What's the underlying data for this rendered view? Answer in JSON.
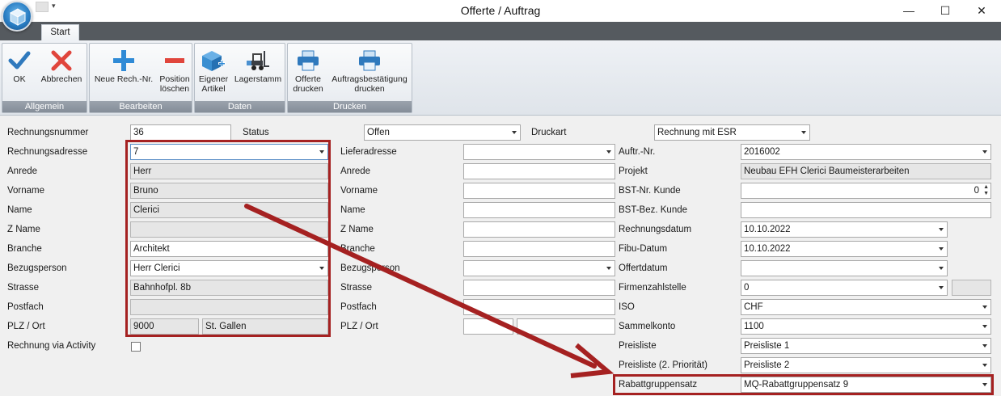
{
  "window": {
    "title": "Offerte / Auftrag",
    "minimize_glyph": "—",
    "maximize_glyph": "☐",
    "close_glyph": "✕"
  },
  "ribbon": {
    "tab": "Start",
    "groups": [
      {
        "label": "Allgemein",
        "buttons": [
          {
            "label": "OK",
            "icon": "check-icon"
          },
          {
            "label": "Abbrechen",
            "icon": "cancel-x-icon"
          }
        ]
      },
      {
        "label": "Bearbeiten",
        "buttons": [
          {
            "label": "Neue Rech.-Nr.",
            "icon": "plus-icon"
          },
          {
            "label": "Position\nlöschen",
            "icon": "minus-icon"
          }
        ]
      },
      {
        "label": "Daten",
        "buttons": [
          {
            "label": "Eigener\nArtikel",
            "icon": "cube-plus-icon"
          },
          {
            "label": "Lagerstamm",
            "icon": "forklift-icon"
          }
        ]
      },
      {
        "label": "Drucken",
        "buttons": [
          {
            "label": "Offerte\ndrucken",
            "icon": "printer-icon"
          },
          {
            "label": "Auftragsbestätigung\ndrucken",
            "icon": "printer-icon"
          }
        ]
      }
    ]
  },
  "header_row": {
    "rechnungsnummer_label": "Rechnungsnummer",
    "rechnungsnummer": "36",
    "status_label": "Status",
    "status": "Offen",
    "druckart_label": "Druckart",
    "druckart": "Rechnung mit ESR"
  },
  "rechnungsadresse": {
    "labels": {
      "adresse": "Rechnungsadresse",
      "anrede": "Anrede",
      "vorname": "Vorname",
      "name": "Name",
      "zname": "Z Name",
      "branche": "Branche",
      "bezugsperson": "Bezugsperson",
      "strasse": "Strasse",
      "postfach": "Postfach",
      "plz_ort": "PLZ / Ort",
      "activity": "Rechnung via Activity"
    },
    "adresse": "7",
    "anrede": "Herr",
    "vorname": "Bruno",
    "name": "Clerici",
    "zname": "",
    "branche": "Architekt",
    "bezugsperson": "Herr Clerici",
    "strasse": "Bahnhofpl. 8b",
    "postfach": "",
    "plz": "9000",
    "ort": "St. Gallen",
    "activity_checked": false
  },
  "lieferadresse": {
    "labels": {
      "adresse": "Lieferadresse",
      "anrede": "Anrede",
      "vorname": "Vorname",
      "name": "Name",
      "zname": "Z Name",
      "branche": "Branche",
      "bezugsperson": "Bezugsperson",
      "strasse": "Strasse",
      "postfach": "Postfach",
      "plz_ort": "PLZ / Ort"
    },
    "adresse": "",
    "anrede": "",
    "vorname": "",
    "name": "",
    "zname": "",
    "branche": "",
    "bezugsperson": "",
    "strasse": "",
    "postfach": "",
    "plz": "",
    "ort": ""
  },
  "auftrag": {
    "labels": {
      "auftr_nr": "Auftr.-Nr.",
      "projekt": "Projekt",
      "bst_nr": "BST-Nr. Kunde",
      "bst_bez": "BST-Bez. Kunde",
      "rechnungsdatum": "Rechnungsdatum",
      "fibu_datum": "Fibu-Datum",
      "offertdatum": "Offertdatum",
      "firmenzahlstelle": "Firmenzahlstelle",
      "iso": "ISO",
      "sammelkonto": "Sammelkonto",
      "preisliste": "Preisliste",
      "preisliste2": "Preisliste (2. Priorität)",
      "rabattgruppensatz": "Rabattgruppensatz"
    },
    "auftr_nr": "2016002",
    "projekt": "Neubau EFH Clerici Baumeisterarbeiten",
    "bst_nr": "0",
    "bst_bez": "",
    "rechnungsdatum": "10.10.2022",
    "fibu_datum": "10.10.2022",
    "offertdatum": "",
    "firmenzahlstelle": "0",
    "firmenzahlstelle_extra": "",
    "iso": "CHF",
    "sammelkonto": "1100",
    "preisliste": "Preisliste 1",
    "preisliste2": "Preisliste 2",
    "rabattgruppensatz": "MQ-Rabattgruppensatz  9"
  },
  "colors": {
    "highlight_red": "#a52121",
    "tabstrip": "#555a5f",
    "readonly_field": "#e6e6e6"
  }
}
